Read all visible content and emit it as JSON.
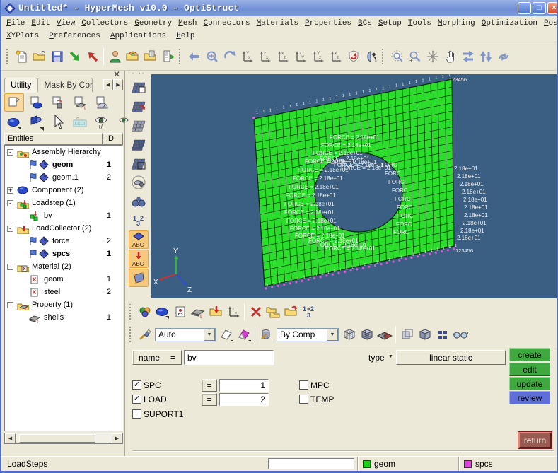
{
  "window": {
    "title": "Untitled* - HyperMesh v10.0 - OptiStruct",
    "controls": [
      "minimize-button",
      "maximize-button",
      "close-button"
    ]
  },
  "menus": {
    "row1": [
      "File",
      "Edit",
      "View",
      "Collectors",
      "Geometry",
      "Mesh",
      "Connectors",
      "Materials",
      "Properties",
      "BCs",
      "Setup",
      "Tools",
      "Morphing",
      "Optimization",
      "Post"
    ],
    "row2": [
      "XYPlots",
      "Preferences",
      "Applications",
      "Help"
    ]
  },
  "icons": {
    "top_toolbar": [
      "new-file",
      "open-file",
      "save-file",
      "import",
      "export",
      "user-profiles",
      "open-model",
      "open-results",
      "export-data",
      "previous-view",
      "zoom-fit",
      "refresh-view",
      "view-axis-xy",
      "view-axis-zx",
      "view-axis-xz",
      "view-axis-zy",
      "view-axis-yz",
      "view-axis-iso",
      "spin-view",
      "mirror-view",
      "zoom-lasso",
      "zoom-in-out",
      "pan-view",
      "grab-view",
      "swap-horizontal",
      "swap-vertical",
      "rotate-view"
    ],
    "viewport_strip": [
      "mask-elements",
      "unmask-adjacent",
      "reverse-mask",
      "mask-all",
      "unmask-region",
      "spotlight",
      "find-entities",
      "renumber-display",
      "label-elements",
      "label-loads",
      "quick-window"
    ],
    "bottom_row1": [
      "assembly-collector",
      "component-collector",
      "material-collector",
      "property-collector",
      "load-collector",
      "system-collector",
      "delete-entity",
      "organize",
      "copy-entities",
      "renumber"
    ],
    "bottom_row2": [
      "display-brush",
      "wireframe-geometry",
      "shaded-geometry",
      "color-bucket",
      "wireframe-elements",
      "shaded-elements",
      "element-quality",
      "overlay-option",
      "solid-cube",
      "checker-squares",
      "visualization-glasses"
    ],
    "label_icon_text": "ABC",
    "renumber_icon_text": "132"
  },
  "left_panel": {
    "tabs": [
      "Utility",
      "Mask By Cor"
    ],
    "tree_header": {
      "entities": "Entities",
      "id": "ID"
    },
    "tree": [
      {
        "label": "Assembly Hierarchy",
        "id": "",
        "icon": "assembly-folder",
        "level": 0,
        "expander": "-",
        "bold": false
      },
      {
        "label": "geom",
        "id": "1",
        "icon": "flag-diamond",
        "level": 1,
        "expander": "",
        "bold": true
      },
      {
        "label": "geom.1",
        "id": "2",
        "icon": "flag-diamond",
        "level": 1,
        "expander": "",
        "bold": false
      },
      {
        "label": "Component (2)",
        "id": "",
        "icon": "component",
        "level": 0,
        "expander": "+",
        "bold": false
      },
      {
        "label": "Loadstep (1)",
        "id": "",
        "icon": "loadstep-folder",
        "level": 0,
        "expander": "-",
        "bold": false
      },
      {
        "label": "bv",
        "id": "1",
        "icon": "loadstep",
        "level": 1,
        "expander": "",
        "bold": false
      },
      {
        "label": "LoadCollector (2)",
        "id": "",
        "icon": "loadcol-folder",
        "level": 0,
        "expander": "-",
        "bold": false
      },
      {
        "label": "force",
        "id": "2",
        "icon": "flag-diamond",
        "level": 1,
        "expander": "",
        "bold": false
      },
      {
        "label": "spcs",
        "id": "1",
        "icon": "flag-diamond",
        "level": 1,
        "expander": "",
        "bold": true
      },
      {
        "label": "Material (2)",
        "id": "",
        "icon": "material-folder",
        "level": 0,
        "expander": "-",
        "bold": false
      },
      {
        "label": "geom",
        "id": "1",
        "icon": "material",
        "level": 1,
        "expander": "",
        "bold": false
      },
      {
        "label": "steel",
        "id": "2",
        "icon": "material",
        "level": 1,
        "expander": "",
        "bold": false
      },
      {
        "label": "Property (1)",
        "id": "",
        "icon": "property-folder",
        "level": 0,
        "expander": "-",
        "bold": false
      },
      {
        "label": "shells",
        "id": "1",
        "icon": "property",
        "level": 1,
        "expander": "",
        "bold": false
      }
    ]
  },
  "viewport": {
    "bg_color": "#3A5F82",
    "mesh_color": "#2CDE2C",
    "force_label": "FORCE = 2.18e+01",
    "force_label_short": "2.18e+01",
    "force_label_clip": "FORC",
    "constraint_label": "123456",
    "constraint_tick": "1",
    "axis_labels": {
      "x": "X",
      "y": "Y",
      "z": "Z"
    },
    "axis_colors": {
      "x": "#D03030",
      "y": "#30C030",
      "z": "#3050D0"
    }
  },
  "bottom_toolbar": {
    "display_mode": "Auto",
    "color_mode": "By Comp"
  },
  "panel": {
    "name_label": "name",
    "eq": "=",
    "name_value": "bv",
    "type_label": "type",
    "type_value": "linear static",
    "actions": [
      "create",
      "edit",
      "update",
      "review"
    ],
    "action_colors": [
      "#3FA93F",
      "#3FA93F",
      "#3FA93F",
      "#5E6FD8"
    ],
    "return_label": "return",
    "checkboxes": [
      {
        "label": "SPC",
        "checked": true,
        "eq": "=",
        "value": "1"
      },
      {
        "label": "LOAD",
        "checked": true,
        "eq": "=",
        "value": "2"
      },
      {
        "label": "SUPORT1",
        "checked": false,
        "eq": "",
        "value": ""
      },
      {
        "label": "MPC",
        "checked": false,
        "eq": "",
        "value": ""
      },
      {
        "label": "TEMP",
        "checked": false,
        "eq": "",
        "value": ""
      }
    ]
  },
  "statusbar": {
    "mode": "LoadSteps",
    "current_component": "geom",
    "component_color": "#22CC22",
    "current_loadcol": "spcs",
    "loadcol_color": "#DD44DD"
  }
}
